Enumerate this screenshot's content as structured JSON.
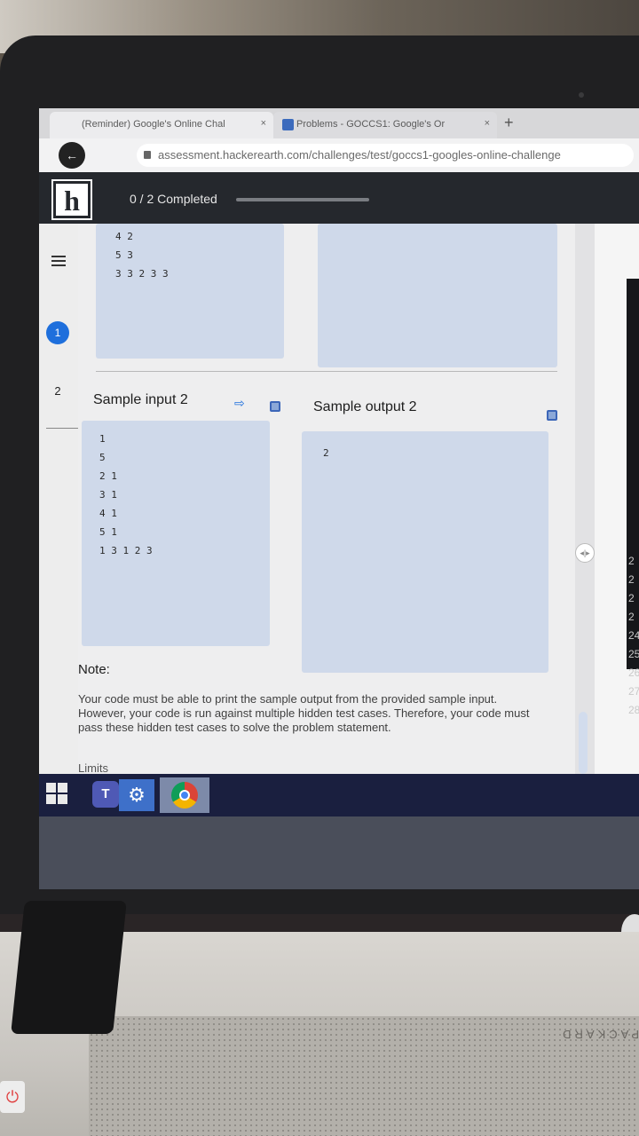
{
  "browser": {
    "tabs": [
      {
        "label": "(Reminder) Google's Online Chal",
        "close": "×"
      },
      {
        "label": "Problems - GOCCS1: Google's Or",
        "close": "×"
      }
    ],
    "new_tab": "+",
    "url": "assessment.hackerearth.com/challenges/test/goccs1-googles-online-challenge"
  },
  "header": {
    "logo": "h",
    "progress_text": "0 / 2 Completed",
    "progress_fraction": 0
  },
  "rail": {
    "questions": [
      "1",
      "2"
    ],
    "active": "1"
  },
  "sample1": {
    "input_lines": [
      "4 2",
      "5 3",
      "3 3 2 3 3"
    ]
  },
  "sample2": {
    "input_title": "Sample input 2",
    "output_title": "Sample output 2",
    "input_lines": [
      "1",
      "5",
      "2 1",
      "3 1",
      "4 1",
      "5 1",
      "1 3 1 2 3"
    ],
    "output_lines": [
      "2"
    ]
  },
  "note": {
    "title": "Note:",
    "body": "Your code must be able to print the sample output from the provided sample input. However, your code is run against multiple hidden test cases. Therefore, your code must pass these hidden test cases to solve the problem statement.",
    "limits": "Limits"
  },
  "editor": {
    "line_numbers": [
      "2",
      "2",
      "2",
      "2",
      "24",
      "25",
      "26",
      "27",
      "28"
    ]
  },
  "taskbar": {
    "teams_label": "T",
    "settings_glyph": "⚙"
  },
  "device": {
    "keyboard_text": "PACKARD"
  },
  "icons": {
    "power": "⏻",
    "out_link": "⇨",
    "splitter": "◂|▸"
  }
}
